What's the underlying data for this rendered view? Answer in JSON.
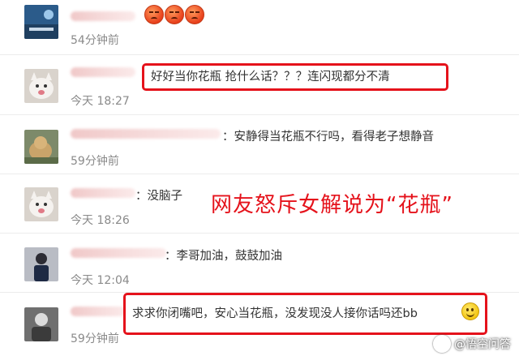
{
  "comments": [
    {
      "text": "",
      "time": "54分钟前",
      "avatar_icon": "blue-landscape-avatar"
    },
    {
      "text": "好好当你花瓶  抢什么话？？？连闪现都分不清",
      "time": "今天 18:27",
      "avatar_icon": "white-cat-avatar"
    },
    {
      "text": "：安静得当花瓶不行吗，看得老子想静音",
      "time": "59分钟前",
      "avatar_icon": "dog-photo-avatar"
    },
    {
      "text": "：没脑子",
      "time": "今天 18:26",
      "avatar_icon": "white-cat-avatar"
    },
    {
      "text": "：李哥加油，鼓鼓加油",
      "time": "今天 12:04",
      "avatar_icon": "person-photo-avatar"
    },
    {
      "text": "求求你闭嘴吧，安心当花瓶，没发现没人接你话吗还bb",
      "time": "59分钟前",
      "avatar_icon": "grey-photo-avatar"
    }
  ],
  "overlay": {
    "caption": "网友怒斥女解说为“花瓶”"
  },
  "watermark": {
    "text": "@悟空问答"
  },
  "colors": {
    "highlight_red": "#e5121b",
    "time_gray": "#8a8a8a"
  }
}
